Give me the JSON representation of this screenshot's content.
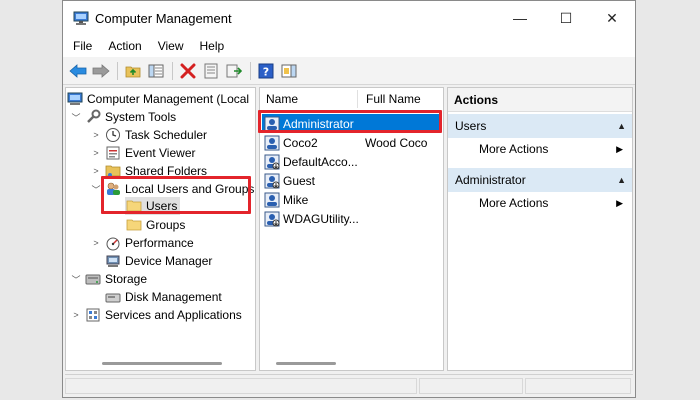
{
  "window": {
    "title": "Computer Management",
    "controls": {
      "minimize": "—",
      "maximize": "☐",
      "close": "✕"
    }
  },
  "menu": [
    "File",
    "Action",
    "View",
    "Help"
  ],
  "tree": {
    "root": "Computer Management (Local",
    "system_tools": "System Tools",
    "task_scheduler": "Task Scheduler",
    "event_viewer": "Event Viewer",
    "shared_folders": "Shared Folders",
    "local_users_groups": "Local Users and Groups",
    "users": "Users",
    "groups": "Groups",
    "performance": "Performance",
    "device_manager": "Device Manager",
    "storage": "Storage",
    "disk_management": "Disk Management",
    "services_apps": "Services and Applications"
  },
  "list": {
    "columns": {
      "name": "Name",
      "full_name": "Full Name"
    },
    "rows": [
      {
        "name": "Administrator",
        "full_name": ""
      },
      {
        "name": "Coco2",
        "full_name": "Wood Coco"
      },
      {
        "name": "DefaultAcco...",
        "full_name": ""
      },
      {
        "name": "Guest",
        "full_name": ""
      },
      {
        "name": "Mike",
        "full_name": ""
      },
      {
        "name": "WDAGUtility...",
        "full_name": ""
      }
    ]
  },
  "actions": {
    "title": "Actions",
    "section1": {
      "header": "Users",
      "item": "More Actions"
    },
    "section2": {
      "header": "Administrator",
      "item": "More Actions"
    }
  },
  "colors": {
    "selection": "#0078d7",
    "highlight_box": "#e3242b",
    "actions_header": "#dbe9f5"
  }
}
